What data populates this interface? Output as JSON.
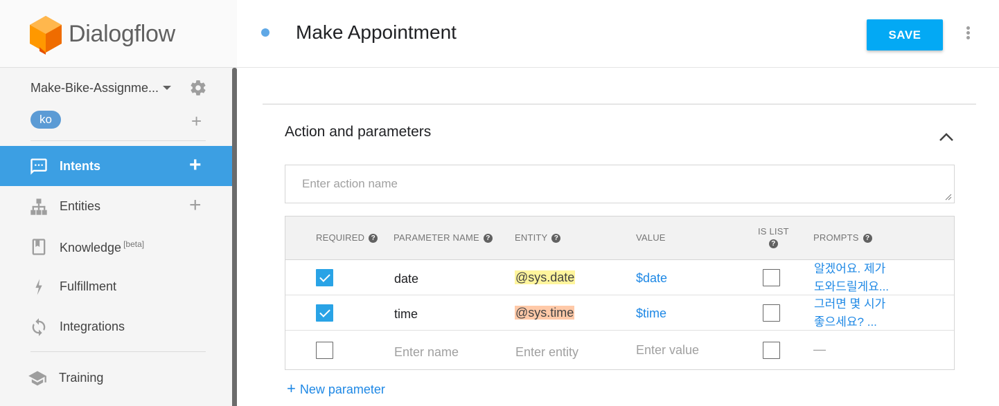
{
  "brand": {
    "name": "Dialogflow"
  },
  "agent": {
    "name": "Make-Bike-Assignme...",
    "language": "ko"
  },
  "nav": {
    "items": [
      {
        "label": "Intents",
        "active": true
      },
      {
        "label": "Entities"
      },
      {
        "label": "Knowledge",
        "badge": "[beta]"
      },
      {
        "label": "Fulfillment"
      },
      {
        "label": "Integrations"
      },
      {
        "label": "Training"
      }
    ]
  },
  "header": {
    "title": "Make Appointment",
    "save_label": "SAVE"
  },
  "section": {
    "title": "Action and parameters",
    "action_placeholder": "Enter action name"
  },
  "table": {
    "headers": {
      "required": "REQUIRED",
      "parameter_name": "PARAMETER NAME",
      "entity": "ENTITY",
      "value": "VALUE",
      "is_list_1": "IS LIST",
      "prompts": "PROMPTS"
    },
    "rows": [
      {
        "required": true,
        "name": "date",
        "entity": "@sys.date",
        "value": "$date",
        "is_list": false,
        "prompt_1": "알겠어요. 제가",
        "prompt_2": "도와드릴게요..."
      },
      {
        "required": true,
        "name": "time",
        "entity": "@sys.time",
        "value": "$time",
        "is_list": false,
        "prompt_1": "그러면 몇 시가",
        "prompt_2": "좋으세요? ..."
      }
    ],
    "empty_row": {
      "name_placeholder": "Enter name",
      "entity_placeholder": "Enter entity",
      "value_placeholder": "Enter value",
      "prompt": "—"
    },
    "new_parameter_label": "New parameter"
  },
  "colors": {
    "accent": "#3c9fe3",
    "save": "#03a9f4",
    "link": "#1e88e5",
    "entity_date": "#fff59d",
    "entity_time": "#ffc9a8"
  }
}
